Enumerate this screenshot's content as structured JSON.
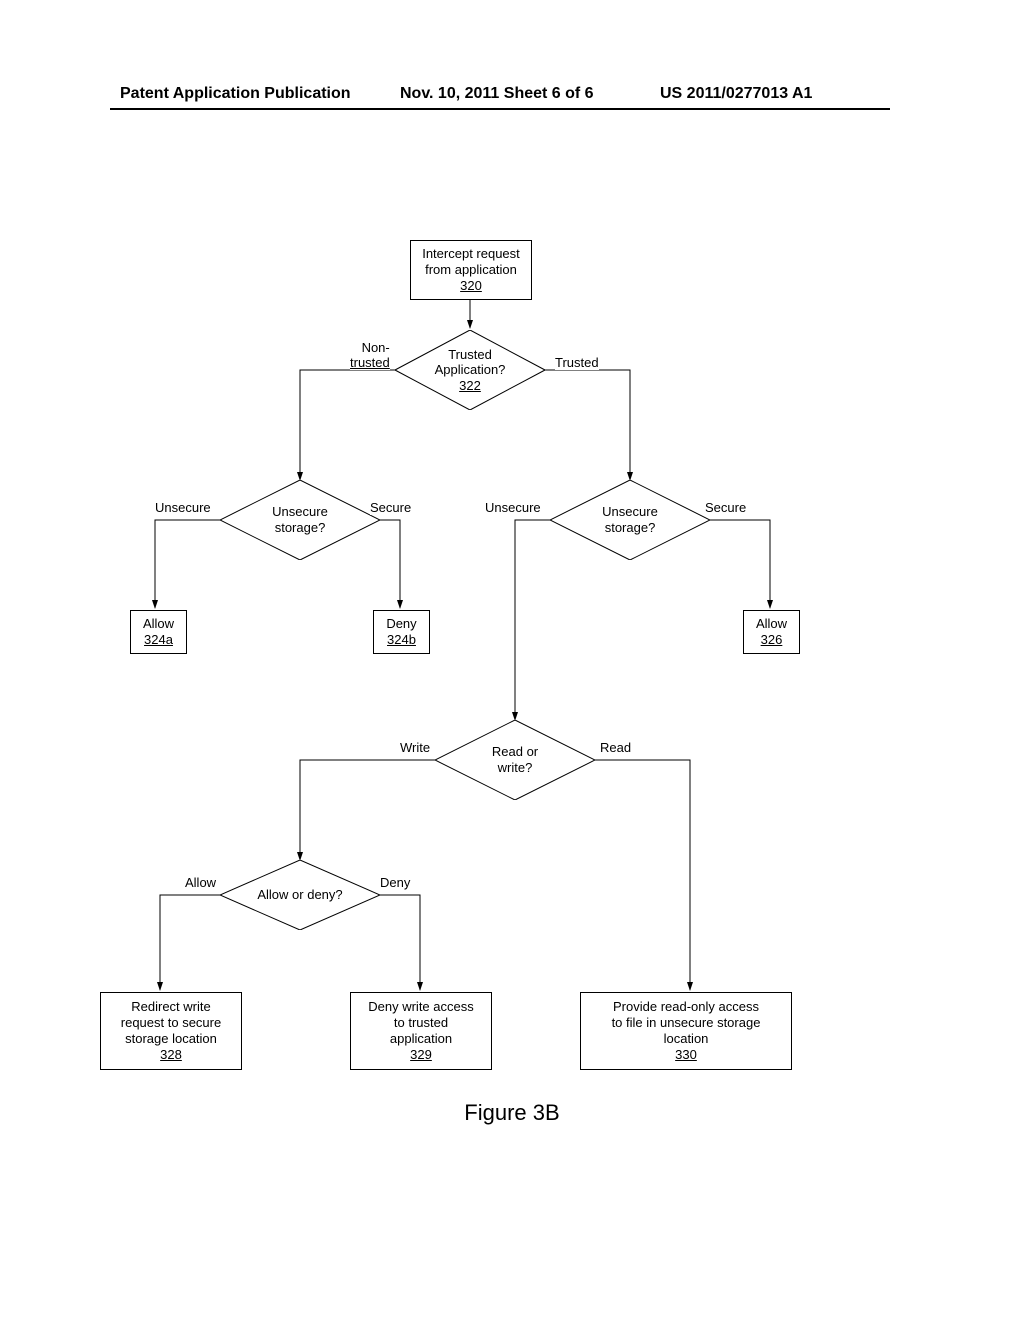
{
  "header": {
    "left": "Patent Application Publication",
    "mid": "Nov. 10, 2011  Sheet 6 of 6",
    "right": "US 2011/0277013 A1"
  },
  "figure_label": "Figure 3B",
  "n320": {
    "l1": "Intercept request",
    "l2": "from application",
    "ref": "320"
  },
  "n322": {
    "l1": "Trusted",
    "l2": "Application?",
    "ref": "322"
  },
  "lbl322_nontrusted_l1": "Non-",
  "lbl322_nontrusted_l2": "trusted",
  "lbl322_trusted": "Trusted",
  "d_left": {
    "l1": "Unsecure",
    "l2": "storage?"
  },
  "d_right": {
    "l1": "Unsecure",
    "l2": "storage?"
  },
  "lbl_dl_unsecure": "Unsecure",
  "lbl_dl_secure": "Secure",
  "lbl_dr_unsecure": "Unsecure",
  "lbl_dr_secure": "Secure",
  "n324a": {
    "l1": "Allow",
    "ref": "324a"
  },
  "n324b": {
    "l1": "Deny",
    "ref": "324b"
  },
  "n326": {
    "l1": "Allow",
    "ref": "326"
  },
  "d_rw": {
    "l1": "Read or",
    "l2": "write?"
  },
  "lbl_rw_write": "Write",
  "lbl_rw_read": "Read",
  "d_ad": {
    "l1": "Allow or deny?"
  },
  "lbl_ad_allow": "Allow",
  "lbl_ad_deny": "Deny",
  "n328": {
    "l1": "Redirect write",
    "l2": "request to secure",
    "l3": "storage location",
    "ref": "328"
  },
  "n329": {
    "l1": "Deny write access",
    "l2": "to trusted",
    "l3": "application",
    "ref": "329"
  },
  "n330": {
    "l1": "Provide read-only access",
    "l2": "to file in unsecure storage",
    "l3": "location",
    "ref": "330"
  }
}
